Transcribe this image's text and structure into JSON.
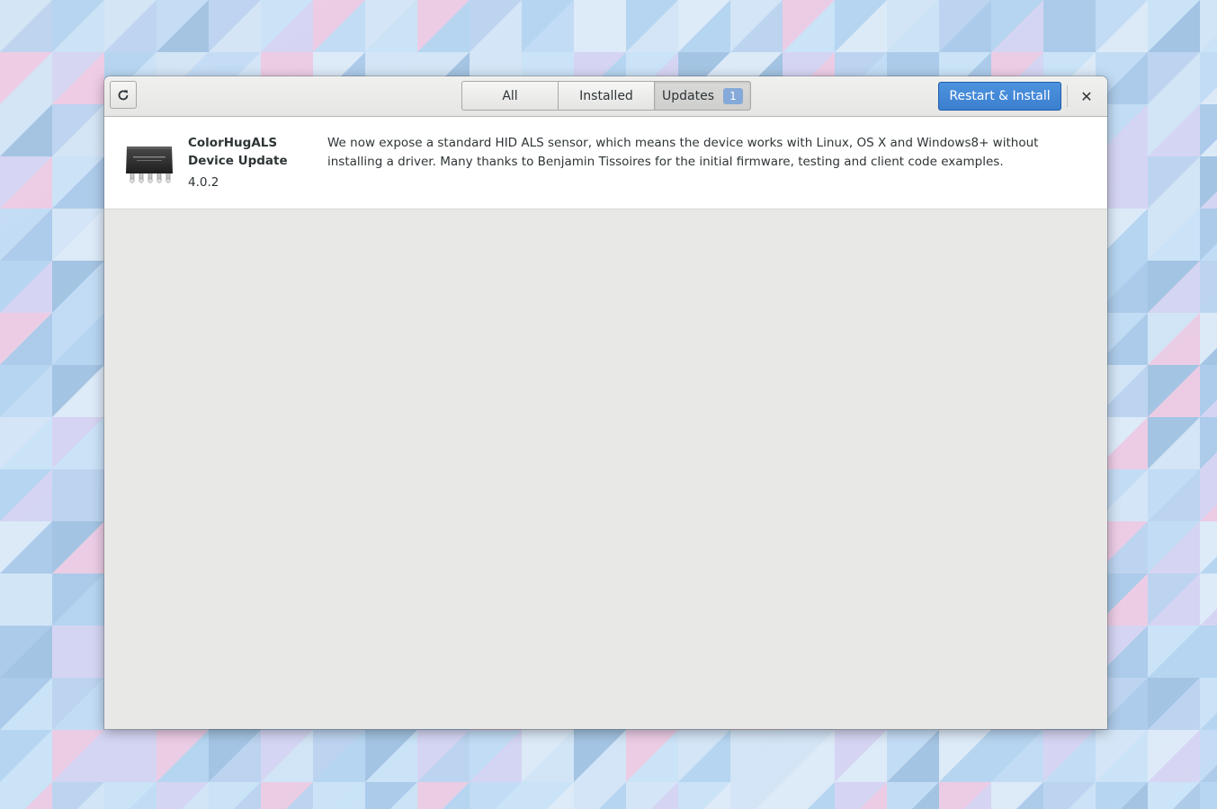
{
  "header": {
    "tabs": [
      {
        "label": "All"
      },
      {
        "label": "Installed"
      },
      {
        "label": "Updates",
        "badge": "1"
      }
    ],
    "restart_label": "Restart & Install",
    "close_glyph": "✕",
    "refresh_icon": "view-refresh-icon"
  },
  "updates": [
    {
      "name": "ColorHugALS Device Update",
      "version": "4.0.2",
      "description": "We now expose a standard HID ALS sensor, which means the device works with Linux, OS X and Windows8+ without installing a driver. Many thanks to Benjamin Tissoires for the initial firmware, testing and client code examples.",
      "icon": "chip-icon"
    }
  ],
  "colors": {
    "accent": "#3b7fcf",
    "badge": "#85a9d8",
    "content_bg": "#e8e8e7"
  }
}
